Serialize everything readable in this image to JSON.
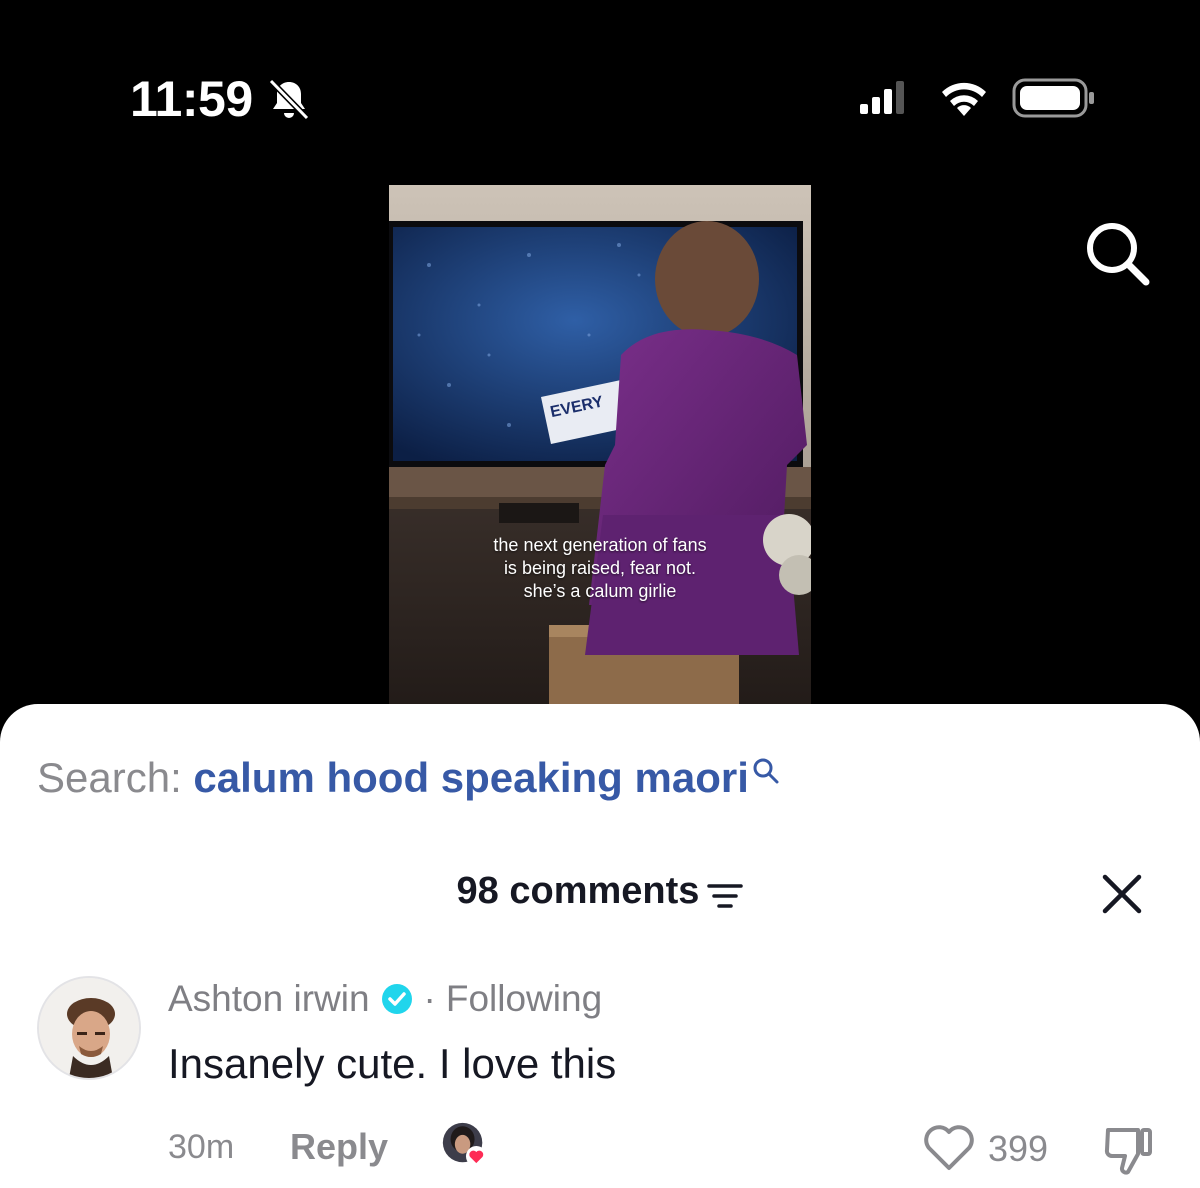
{
  "status_bar": {
    "time": "11:59",
    "icons": [
      "bell-slash-icon",
      "signal-icon",
      "wifi-icon",
      "battery-icon"
    ]
  },
  "top_bar": {
    "search_icon": "search-icon"
  },
  "video": {
    "caption_lines": [
      "the next generation of fans",
      "is being raised, fear not.",
      "she’s a calum girlie"
    ],
    "tv_text": "EVERY"
  },
  "sheet": {
    "search_prefix": "Search: ",
    "search_query": "calum hood speaking maori",
    "comments_count": "98 comments",
    "comment": {
      "author": "Ashton irwin",
      "verified": true,
      "separator": "·",
      "relation": "Following",
      "text": "Insanely cute. I love this",
      "time": "30m",
      "reply_label": "Reply",
      "likes": "399"
    }
  },
  "colors": {
    "link": "#3759a6",
    "muted": "#8a8a8e",
    "verified": "#20d5ec",
    "heart": "#fe2c55"
  }
}
